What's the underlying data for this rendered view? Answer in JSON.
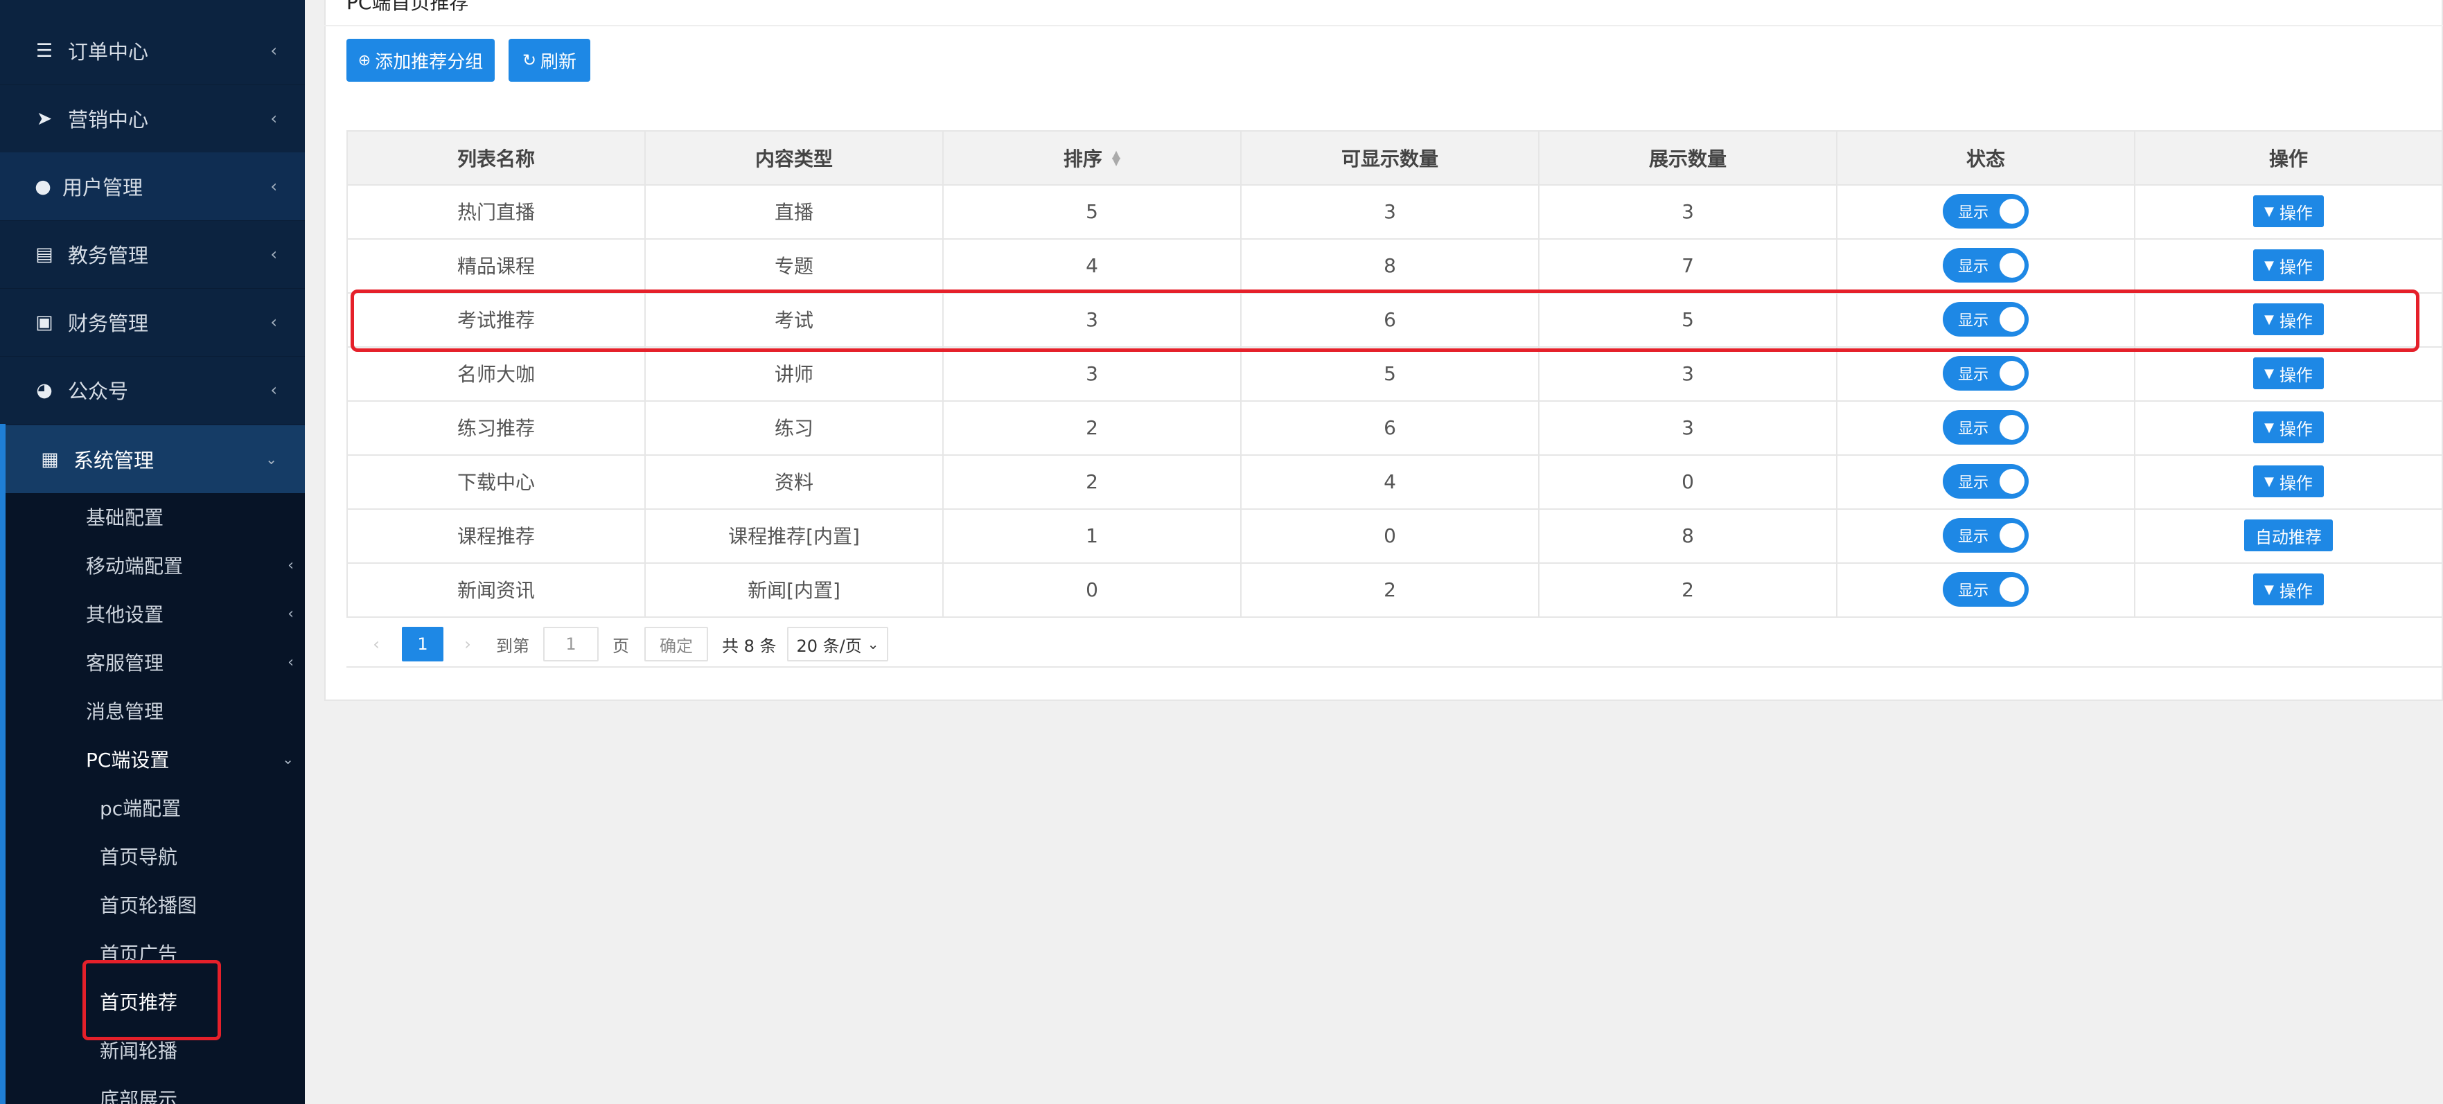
{
  "sidebar": {
    "items": [
      {
        "label": "订单中心",
        "icon": "list-icon"
      },
      {
        "label": "营销中心",
        "icon": "paper-plane-icon"
      },
      {
        "label": "用户管理",
        "icon": "user-icon"
      },
      {
        "label": "教务管理",
        "icon": "book-icon"
      },
      {
        "label": "财务管理",
        "icon": "money-icon"
      },
      {
        "label": "公众号",
        "icon": "wechat-icon"
      },
      {
        "label": "系统管理",
        "icon": "grid-icon"
      }
    ],
    "sub_items": [
      "基础配置",
      "移动端配置",
      "其他设置",
      "客服管理",
      "消息管理",
      "PC端设置"
    ],
    "pc_items": [
      "pc端配置",
      "首页导航",
      "首页轮播图",
      "首页广告",
      "首页推荐",
      "新闻轮播",
      "底部展示"
    ]
  },
  "page": {
    "title": "PC端首页推荐"
  },
  "toolbar": {
    "add_label": "添加推荐分组",
    "refresh_label": "刷新"
  },
  "table": {
    "headers": [
      "列表名称",
      "内容类型",
      "排序",
      "可显示数量",
      "展示数量",
      "状态",
      "操作"
    ],
    "rows": [
      {
        "name": "热门直播",
        "type": "直播",
        "sort": "5",
        "visible": "3",
        "shown": "3",
        "status": "显示",
        "action": "操作"
      },
      {
        "name": "精品课程",
        "type": "专题",
        "sort": "4",
        "visible": "8",
        "shown": "7",
        "status": "显示",
        "action": "操作"
      },
      {
        "name": "考试推荐",
        "type": "考试",
        "sort": "3",
        "visible": "6",
        "shown": "5",
        "status": "显示",
        "action": "操作"
      },
      {
        "name": "名师大咖",
        "type": "讲师",
        "sort": "3",
        "visible": "5",
        "shown": "3",
        "status": "显示",
        "action": "操作"
      },
      {
        "name": "练习推荐",
        "type": "练习",
        "sort": "2",
        "visible": "6",
        "shown": "3",
        "status": "显示",
        "action": "操作"
      },
      {
        "name": "下载中心",
        "type": "资料",
        "sort": "2",
        "visible": "4",
        "shown": "0",
        "status": "显示",
        "action": "操作"
      },
      {
        "name": "课程推荐",
        "type": "课程推荐[内置]",
        "sort": "1",
        "visible": "0",
        "shown": "8",
        "status": "显示",
        "action": "自动推荐"
      },
      {
        "name": "新闻资讯",
        "type": "新闻[内置]",
        "sort": "0",
        "visible": "2",
        "shown": "2",
        "status": "显示",
        "action": "操作"
      }
    ]
  },
  "pager": {
    "current_page": "1",
    "goto_label": "到第",
    "goto_value": "1",
    "page_label": "页",
    "confirm_label": "确定",
    "total": "共 8 条",
    "page_size": "20 条/页"
  },
  "colors": {
    "accent": "#1e88e5",
    "sidebar": "#0c2340",
    "highlight": "#e5202a"
  }
}
